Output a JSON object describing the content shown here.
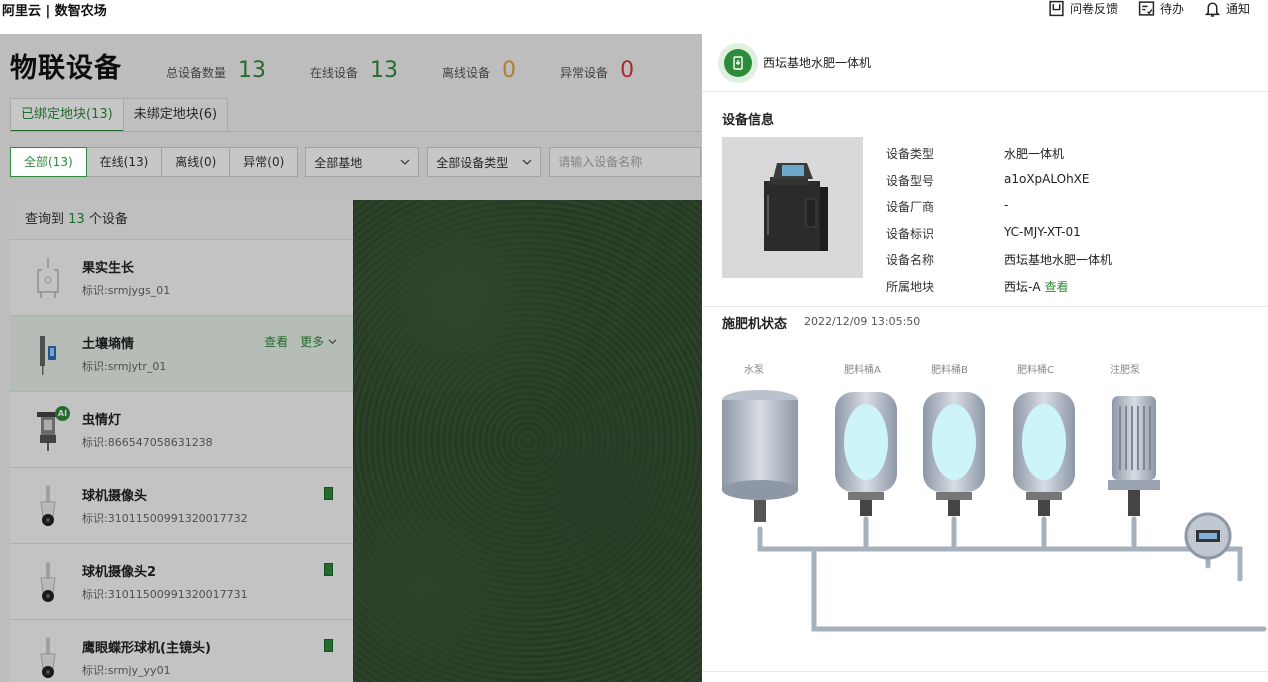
{
  "app": {
    "brand": "阿里云 | 数智农场"
  },
  "topbar": {
    "items": [
      {
        "label": "问卷反馈",
        "icon": "survey-icon"
      },
      {
        "label": "待办",
        "icon": "todo-icon"
      },
      {
        "label": "通知",
        "icon": "bell-icon"
      }
    ]
  },
  "page": {
    "title": "物联设备",
    "stats": [
      {
        "label": "总设备数量",
        "value": "13",
        "color": "#2e8b3c"
      },
      {
        "label": "在线设备",
        "value": "13",
        "color": "#2e8b3c"
      },
      {
        "label": "离线设备",
        "value": "0",
        "color": "#e6a23c"
      },
      {
        "label": "异常设备",
        "value": "0",
        "color": "#d9363e"
      }
    ],
    "tabs": [
      "已绑定地块(13)",
      "未绑定地块(6)"
    ],
    "filters": {
      "buttons": [
        "全部(13)",
        "在线(13)",
        "离线(0)",
        "异常(0)"
      ],
      "base_select": "全部基地",
      "type_select": "全部设备类型",
      "search_placeholder": "请输入设备名称"
    }
  },
  "list": {
    "head_prefix": "查询到 ",
    "count": "13",
    "head_suffix": " 个设备",
    "action_view": "查看",
    "action_more": "更多",
    "items": [
      {
        "name": "果实生长",
        "id": "标识:srmjygs_01",
        "icon": "fruit-sensor-icon"
      },
      {
        "name": "土壤墒情",
        "id": "标识:srmjytr_01",
        "icon": "soil-sensor-icon"
      },
      {
        "name": "虫情灯",
        "id": "标识:866547058631238",
        "icon": "insect-lamp-icon",
        "badge": "AI"
      },
      {
        "name": "球机摄像头",
        "id": "标识:31011500991320017732",
        "icon": "dome-camera-icon"
      },
      {
        "name": "球机摄像头2",
        "id": "标识:31011500991320017731",
        "icon": "dome-camera-icon"
      },
      {
        "name": "鹰眼蝶形球机(主镜头)",
        "id": "标识:srmjy_yy01",
        "icon": "dome-camera-icon"
      }
    ]
  },
  "panel": {
    "title": "西坛基地水肥一体机",
    "info_title": "设备信息",
    "info": [
      {
        "k": "设备类型",
        "v": "水肥一体机"
      },
      {
        "k": "设备型号",
        "v": "a1oXpALOhXE"
      },
      {
        "k": "设备厂商",
        "v": "-"
      },
      {
        "k": "设备标识",
        "v": "YC-MJY-XT-01"
      },
      {
        "k": "设备名称",
        "v": "西坛基地水肥一体机"
      },
      {
        "k": "所属地块",
        "v": "西坛-A",
        "link": "查看"
      }
    ],
    "status_title": "施肥机状态",
    "status_time": "2022/12/09 13:05:50",
    "diagram_labels": [
      "水泵",
      "肥料桶A",
      "肥料桶B",
      "肥料桶C",
      "注肥泵"
    ]
  }
}
